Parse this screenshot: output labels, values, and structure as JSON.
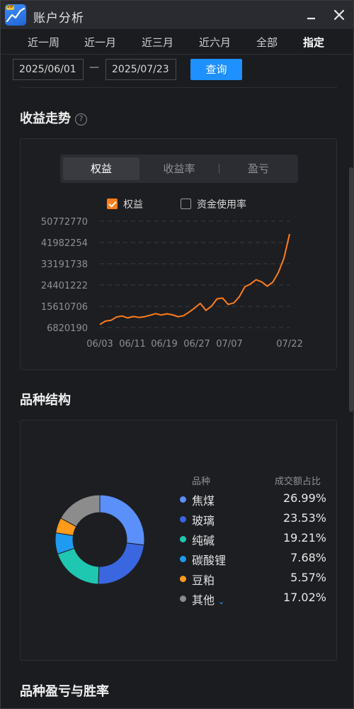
{
  "window": {
    "title": "账户分析",
    "minimize_icon": "minimize-icon",
    "close_icon": "close-icon",
    "app_icon": "trend-chart-icon"
  },
  "tabs": [
    {
      "label": "近一周"
    },
    {
      "label": "近一月"
    },
    {
      "label": "近三月"
    },
    {
      "label": "近六月"
    },
    {
      "label": "全部"
    },
    {
      "label": "指定",
      "active": true
    }
  ],
  "date_filter": {
    "start": "2025/06/01",
    "separator": "—",
    "end": "2025/07/23",
    "query_label": "查询"
  },
  "profit_section": {
    "title": "收益走势",
    "help_icon": "question-circle-icon",
    "segments": [
      {
        "label": "权益",
        "active": true
      },
      {
        "label": "收益率"
      },
      {
        "label": "盈亏"
      }
    ],
    "legend": [
      {
        "label": "权益",
        "checked": true,
        "color": "#ff7d1a"
      },
      {
        "label": "资金使用率",
        "checked": false
      }
    ]
  },
  "chart_data": {
    "type": "line",
    "series": [
      {
        "name": "权益",
        "color": "#ff7d1a",
        "values": [
          8100000,
          9500000,
          9800000,
          11200000,
          11600000,
          10800000,
          11400000,
          11000000,
          11300000,
          11900000,
          12600000,
          12000000,
          12500000,
          12100000,
          11300000,
          11700000,
          13200000,
          14900000,
          16800000,
          13900000,
          15600000,
          18700000,
          19000000,
          16400000,
          17000000,
          19600000,
          23700000,
          24800000,
          26600000,
          25700000,
          23900000,
          25600000,
          29600000,
          35500000,
          45500000
        ]
      }
    ],
    "x_tick_labels": [
      "06/03",
      "06/11",
      "06/19",
      "06/27",
      "07/07",
      "07/22"
    ],
    "y_tick_labels": [
      "50772770",
      "41982254",
      "33191738",
      "24401222",
      "15610706",
      "6820190"
    ],
    "ylim": [
      6820190,
      50772770
    ],
    "grid": true
  },
  "variety_section": {
    "title": "品种结构",
    "col_name": "品种",
    "col_value": "成交额占比",
    "items": [
      {
        "name": "焦煤",
        "value": "26.99%",
        "pct": 26.99,
        "color": "#5b8ff9"
      },
      {
        "name": "玻璃",
        "value": "23.53%",
        "pct": 23.53,
        "color": "#3a66e0"
      },
      {
        "name": "纯碱",
        "value": "19.21%",
        "pct": 19.21,
        "color": "#1fc7b0"
      },
      {
        "name": "碳酸锂",
        "value": "7.68%",
        "pct": 7.68,
        "color": "#1e9bf0"
      },
      {
        "name": "豆粕",
        "value": "5.57%",
        "pct": 5.57,
        "color": "#ff9a1a"
      },
      {
        "name": "其他",
        "value": "17.02%",
        "pct": 17.02,
        "color": "#8c8c8c",
        "expand_icon": "chevron-down-icon"
      }
    ]
  },
  "winrate_section": {
    "title": "品种盈亏与胜率"
  }
}
